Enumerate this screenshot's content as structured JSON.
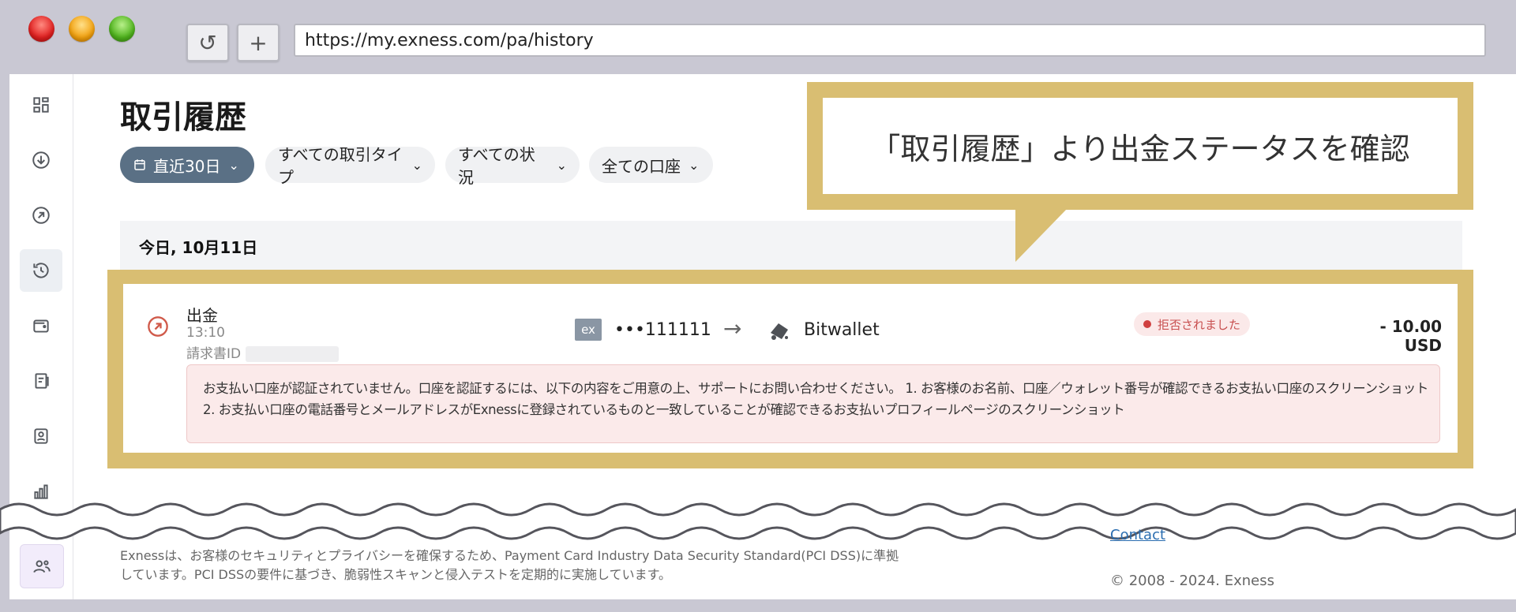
{
  "browser": {
    "url": "https://my.exness.com/pa/history",
    "reload_label": "↺",
    "new_tab_label": "+"
  },
  "page": {
    "title": "取引履歴",
    "filters": [
      {
        "label": "直近30日",
        "chev": "⌄"
      },
      {
        "label": "すべての取引タイプ",
        "chev": "⌄"
      },
      {
        "label": "すべての状況",
        "chev": "⌄"
      },
      {
        "label": "全ての口座",
        "chev": "⌄"
      }
    ],
    "date_group": "今日, 10月11日"
  },
  "transaction": {
    "type": "出金",
    "time": "13:10",
    "invoice_label": "請求書ID",
    "source_badge": "ex",
    "source_account": "•••111111",
    "arrow": "→",
    "destination": "Bitwallet",
    "status": "拒否されました",
    "amount": "- 10.00 USD",
    "error_line1": "お支払い口座が認証されていません。口座を認証するには、以下の内容をご用意の上、サポートにお問い合わせください。 1. お客様のお名前、口座／ウォレット番号が確認できるお支払い口座のスクリーンショット",
    "error_line2": "2. お支払い口座の電話番号とメールアドレスがExnessに登録されているものと一致していることが確認できるお支払いプロフィールページのスクリーンショット"
  },
  "callout": {
    "text": "「取引履歴」より出金ステータスを確認"
  },
  "footer": {
    "security_text_1": "Exnessは、お客様のセキュリティとプライバシーを確保するため、Payment Card Industry Data Security Standard(PCI DSS)に準拠",
    "security_text_2": "しています。PCI DSSの要件に基づき、脆弱性スキャンと侵入テストを定期的に実施しています。",
    "contact_label": "Contact",
    "copyright": "© 2008 - 2024. Exness"
  },
  "colors": {
    "highlight": "#d9be72",
    "primary_chip": "#5a7085",
    "rejected": "#d04040"
  }
}
